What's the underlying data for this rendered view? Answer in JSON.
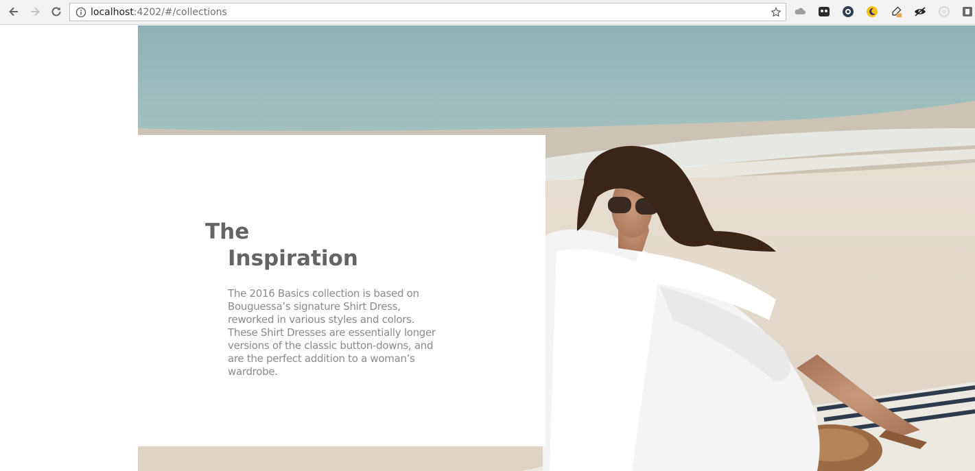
{
  "browser": {
    "url_host": "localhost",
    "url_path": ":4202/#/collections",
    "icons": {
      "back": "back-arrow-icon",
      "forward": "forward-arrow-icon",
      "reload": "reload-icon",
      "info": "info-icon",
      "bookmark": "star-icon"
    },
    "extensions": [
      "cloud-extension-icon",
      "ghostery-extension-icon",
      "privacy-extension-icon",
      "moon-extension-icon",
      "eyedropper-extension-icon",
      "eye-extension-icon",
      "circle-extension-icon",
      "menu-extension-icon"
    ]
  },
  "inspiration": {
    "title_line1": "The",
    "title_line2": "Inspiration",
    "body_lines": [
      "The 2016 Basics collection is based on",
      "Bouguessa’s signature Shirt Dress,",
      "reworked in various styles and colors.",
      "These Shirt Dresses are essentially longer",
      "versions of the classic button-downs, and",
      "are the perfect addition to a woman’s",
      "wardrobe."
    ]
  },
  "colors": {
    "heading": "#646464",
    "body": "#8a8a8a",
    "sea": "#9dbcbd",
    "sand": "#e6ddd2"
  }
}
